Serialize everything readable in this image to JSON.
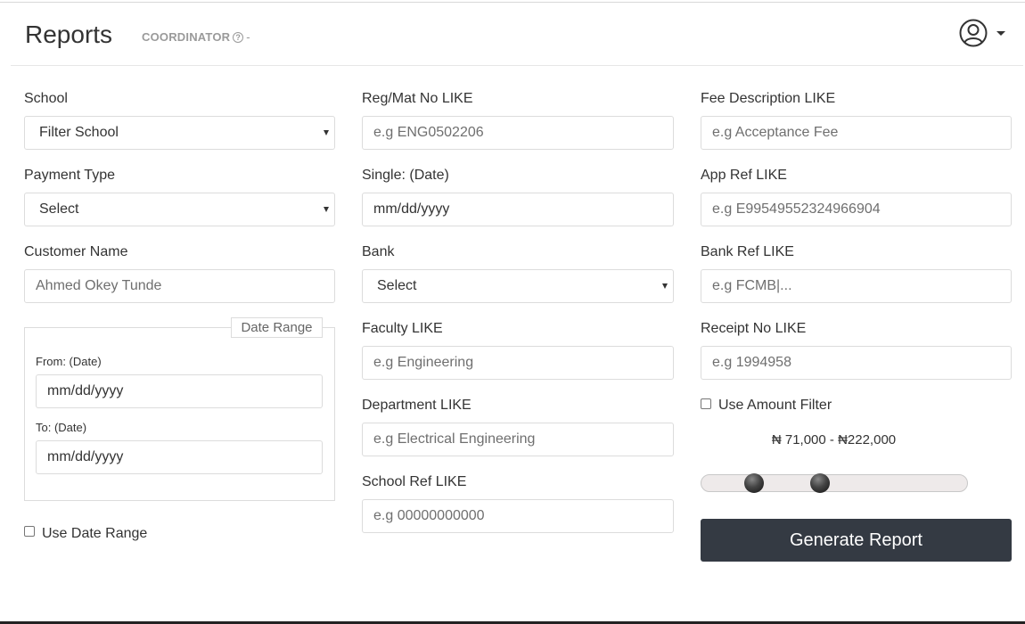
{
  "header": {
    "title": "Reports",
    "role": "COORDINATOR",
    "role_help_icon": "?",
    "role_suffix": "-",
    "user_icon": "user-circle-icon"
  },
  "left": {
    "school": {
      "label": "School",
      "value": "Filter School"
    },
    "payment_type": {
      "label": "Payment Type",
      "value": "Select"
    },
    "customer_name": {
      "label": "Customer Name",
      "placeholder": "Ahmed Okey Tunde"
    },
    "date_range": {
      "legend": "Date Range",
      "from_label": "From: (Date)",
      "from_value": "mm/dd/yyyy",
      "to_label": "To: (Date)",
      "to_value": "mm/dd/yyyy"
    },
    "use_date_range": {
      "label": "Use Date Range",
      "checked": false
    }
  },
  "middle": {
    "reg_mat": {
      "label": "Reg/Mat No LIKE",
      "placeholder": "e.g ENG0502206"
    },
    "single_date": {
      "label": "Single: (Date)",
      "value": "mm/dd/yyyy"
    },
    "bank": {
      "label": "Bank",
      "value": "Select"
    },
    "faculty": {
      "label": "Faculty LIKE",
      "placeholder": "e.g Engineering"
    },
    "department": {
      "label": "Department LIKE",
      "placeholder": "e.g Electrical Engineering"
    },
    "school_ref": {
      "label": "School Ref LIKE",
      "placeholder": "e.g 00000000000"
    }
  },
  "right": {
    "fee_description": {
      "label": "Fee Description LIKE",
      "placeholder": "e.g Acceptance Fee"
    },
    "app_ref": {
      "label": "App Ref LIKE",
      "placeholder": "e.g E99549552324966904"
    },
    "bank_ref": {
      "label": "Bank Ref LIKE",
      "placeholder": "e.g FCMB|..."
    },
    "receipt_no": {
      "label": "Receipt No LIKE",
      "placeholder": "e.g 1994958"
    },
    "use_amount_filter": {
      "label": "Use Amount Filter",
      "checked": false
    },
    "amount_range_text": "₦ 71,000 - ₦222,000",
    "amount_range": {
      "min_fraction": 0.2,
      "max_fraction": 0.447
    },
    "generate_label": "Generate Report"
  },
  "colors": {
    "button": "#343a43",
    "slider_track": "#eeeaea"
  }
}
